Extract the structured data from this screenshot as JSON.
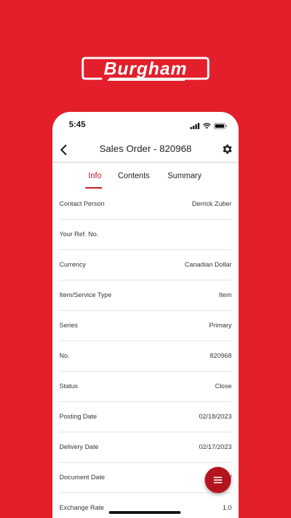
{
  "brand": {
    "logo_text": "Burgham",
    "background_color": "#e21f2b",
    "accent_color": "#c2141f"
  },
  "status_bar": {
    "time": "5:45",
    "icons": [
      "signal-icon",
      "wifi-icon",
      "battery-icon"
    ]
  },
  "header": {
    "title": "Sales Order - 820968",
    "back_icon": "chevron-left-icon",
    "settings_icon": "gear-icon"
  },
  "tabs": [
    {
      "label": "Info",
      "active": true
    },
    {
      "label": "Contents",
      "active": false
    },
    {
      "label": "Summary",
      "active": false
    }
  ],
  "fields": [
    {
      "label": "Contact Person",
      "value": "Derrick Zuber"
    },
    {
      "label": "Your Ref. No.",
      "value": ""
    },
    {
      "label": "Currency",
      "value": "Canadian Dollar"
    },
    {
      "label": "Item/Service Type",
      "value": "Item"
    },
    {
      "label": "Series",
      "value": "Primary"
    },
    {
      "label": "No.",
      "value": "820968"
    },
    {
      "label": "Status",
      "value": "Close"
    },
    {
      "label": "Posting Date",
      "value": "02/18/2023"
    },
    {
      "label": "Delivery Date",
      "value": "02/17/2023"
    },
    {
      "label": "Document Date",
      "value": "02/"
    },
    {
      "label": "Exchange Rate",
      "value": "1.0"
    }
  ],
  "fab": {
    "icon": "menu-icon"
  }
}
